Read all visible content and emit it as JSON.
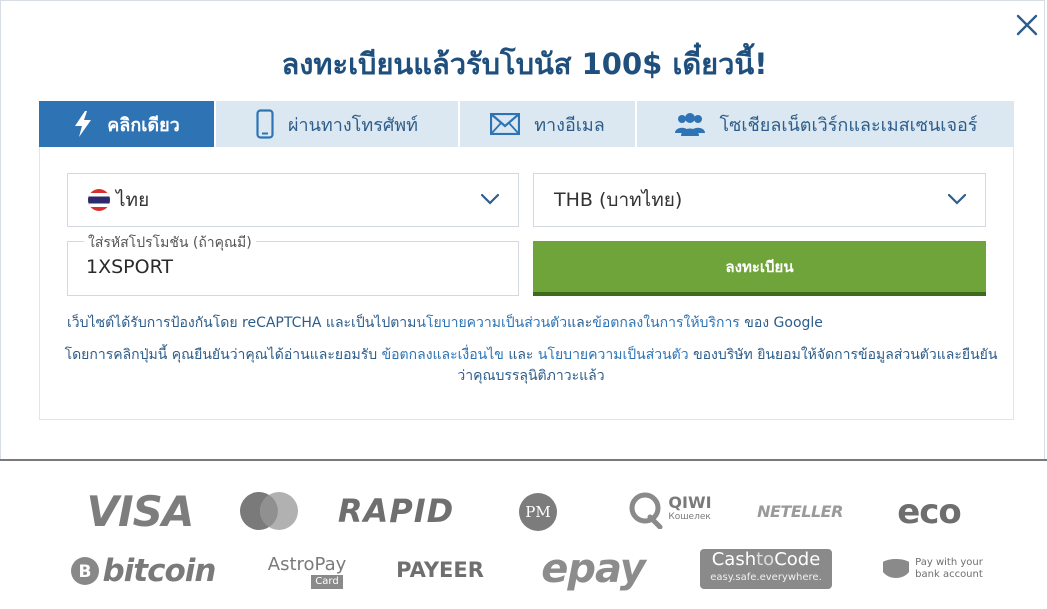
{
  "modal": {
    "title": "ลงทะเบียนแล้วรับโบนัส 100$ เดี๋ยวนี้!"
  },
  "tabs": [
    {
      "label": "คลิกเดียว",
      "icon": "lightning-icon",
      "active": true
    },
    {
      "label": "ผ่านทางโทรศัพท์",
      "icon": "phone-icon",
      "active": false
    },
    {
      "label": "ทางอีเมล",
      "icon": "mail-icon",
      "active": false
    },
    {
      "label": "โซเชียลเน็ตเวิร์กและเมสเซนเจอร์",
      "icon": "users-icon",
      "active": false
    }
  ],
  "form": {
    "country": "ไทย",
    "currency": "THB (บาทไทย)",
    "promo_label": "ใส่รหัสโปรโมชัน (ถ้าคุณมี)",
    "promo_value": "1XSPORT",
    "register_label": "ลงทะเบียน"
  },
  "captcha": {
    "prefix": "เว็บไซต์ได้รับการป้องกันโดย reCAPTCHA และเป็นไปตาม",
    "privacy_link": "นโยบายความเป็นส่วนตัว",
    "and": "และ",
    "terms_link": "ข้อตกลงในการให้บริการ",
    "suffix": "ของ Google"
  },
  "terms": {
    "prefix": "โดยการคลิกปุ่มนี้ คุณยืนยันว่าคุณได้อ่านและยอมรับ",
    "terms_link": "ข้อตกลงและเงื่อนไข",
    "and": "และ",
    "privacy_link": "นโยบายความเป็นส่วนตัว",
    "suffix": "ของบริษัท ยินยอมให้จัดการข้อมูลส่วนตัวและยืนยันว่าคุณบรรลุนิติภาวะแล้ว"
  },
  "payments": {
    "visa": "VISA",
    "rapid": "RAPID",
    "pm": "PM",
    "qiwi": "QIWI",
    "qiwi_sub": "Кошелек",
    "neteller": "NETELLER",
    "eco": "eco",
    "bitcoin": "bitcoin",
    "astro": "AstroPay",
    "astro_card": "Card",
    "payeer": "PAYEER",
    "epay": "epay",
    "cashtocode_1": "Cash",
    "cashtocode_2": "to",
    "cashtocode_3": "Code",
    "cashtocode_sub": "easy.safe.everywhere.",
    "bank_1": "Pay with your",
    "bank_2": "bank account"
  },
  "colors": {
    "title": "#1f4f7c",
    "tab_active": "#2e74b5",
    "tab_bg": "#dbe8f2",
    "register": "#6ea43a",
    "link": "#2e74b5"
  }
}
